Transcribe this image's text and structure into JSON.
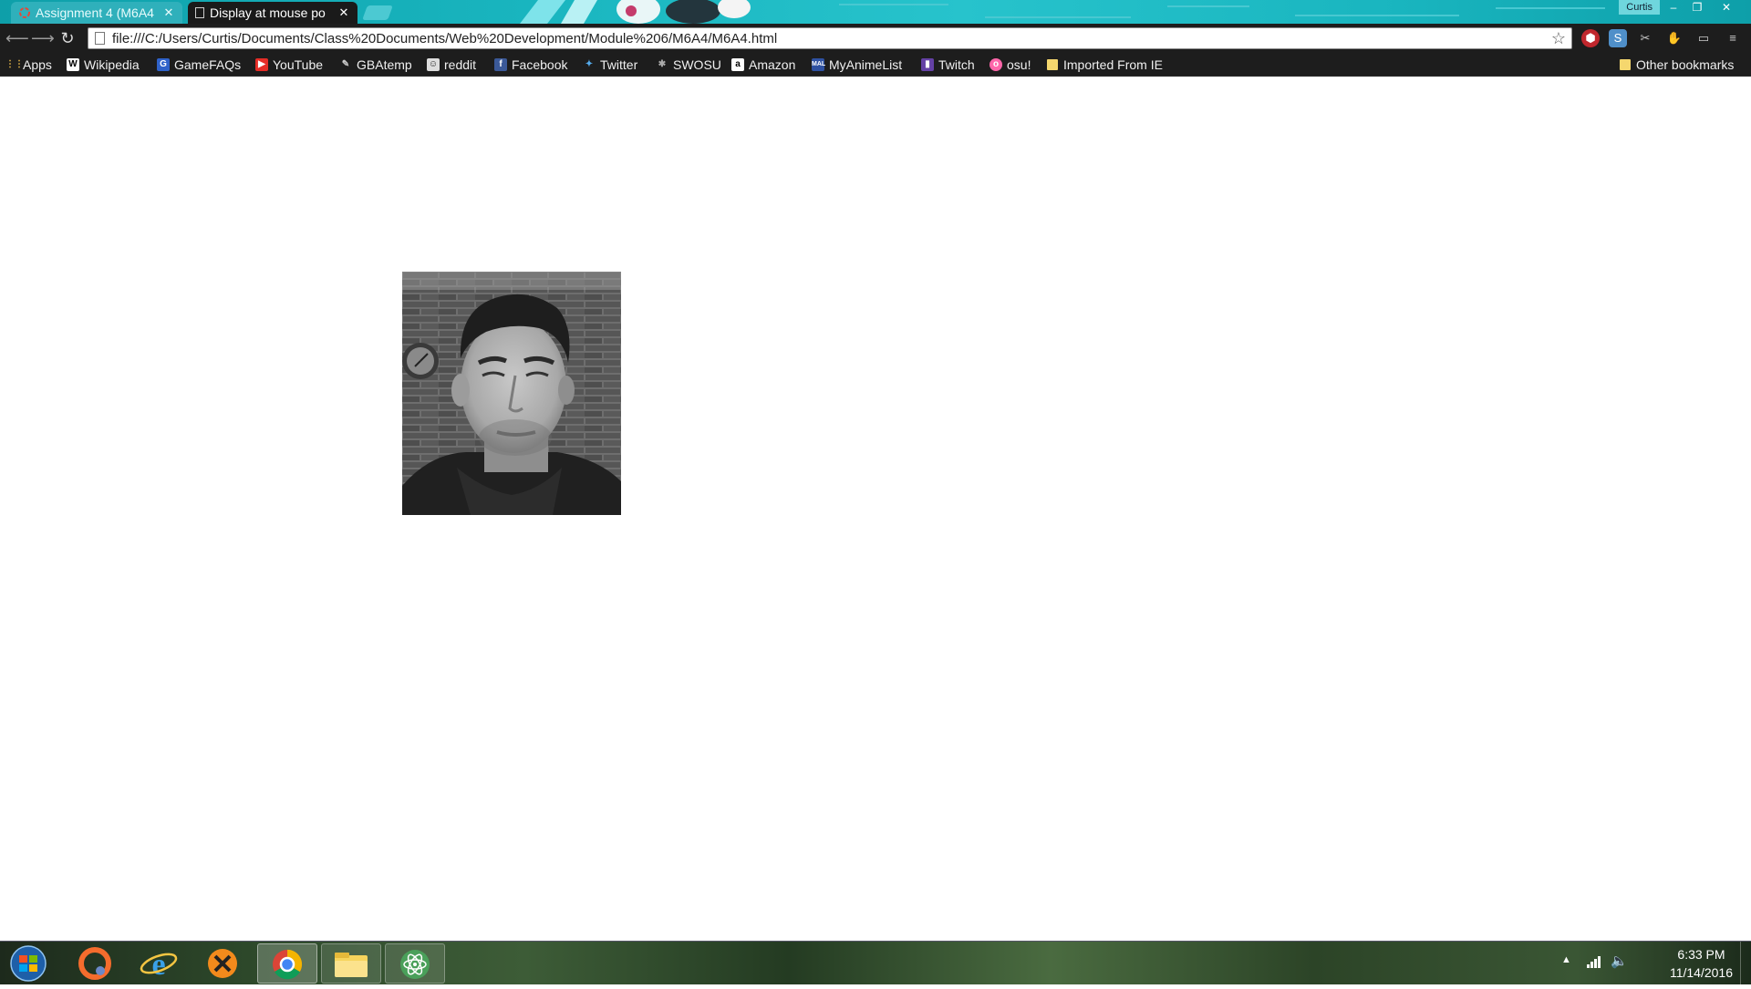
{
  "browser": {
    "tabs": [
      {
        "label": "Assignment 4 (M6A4",
        "active": false
      },
      {
        "label": "Display at mouse po",
        "active": true
      }
    ],
    "user": "Curtis",
    "address": "file:///C:/Users/Curtis/Documents/Class%20Documents/Web%20Development/Module%206/M6A4/M6A4.html",
    "icons": {
      "back": "back-arrow-icon",
      "forward": "forward-arrow-icon",
      "reload": "reload-icon",
      "star": "star-icon",
      "menu": "menu-icon"
    },
    "theme_color": "#19b5bf"
  },
  "bookmarks": [
    {
      "label": "Apps",
      "icon": "apps-grid-icon"
    },
    {
      "label": "Wikipedia",
      "icon": "wikipedia-icon"
    },
    {
      "label": "GameFAQs",
      "icon": "gamefaqs-icon"
    },
    {
      "label": "YouTube",
      "icon": "youtube-icon"
    },
    {
      "label": "GBAtemp",
      "icon": "gbatemp-icon"
    },
    {
      "label": "reddit",
      "icon": "reddit-icon"
    },
    {
      "label": "Facebook",
      "icon": "facebook-icon"
    },
    {
      "label": "Twitter",
      "icon": "twitter-icon"
    },
    {
      "label": "SWOSU",
      "icon": "swosu-icon"
    },
    {
      "label": "Amazon",
      "icon": "amazon-icon"
    },
    {
      "label": "MyAnimeList",
      "icon": "myanimelist-icon"
    },
    {
      "label": "Twitch",
      "icon": "twitch-icon"
    },
    {
      "label": "osu!",
      "icon": "osu-icon"
    },
    {
      "label": "Imported From IE",
      "icon": "folder-icon"
    }
  ],
  "other_bookmarks": "Other bookmarks",
  "taskbar": {
    "apps": [
      "windows-start-icon",
      "origin-icon",
      "internet-explorer-icon",
      "xsplit-icon",
      "chrome-icon",
      "file-explorer-icon",
      "atom-icon"
    ],
    "active_app": "chrome-icon",
    "time": "6:33 PM",
    "date": "11/14/2016"
  }
}
